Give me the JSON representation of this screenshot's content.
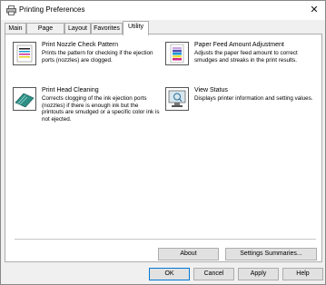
{
  "window": {
    "title": "Printing Preferences",
    "close_glyph": "✕"
  },
  "tabs": [
    {
      "label": "Main"
    },
    {
      "label": "Page Setup"
    },
    {
      "label": "Layout"
    },
    {
      "label": "Favorites"
    },
    {
      "label": "Utility",
      "active": true
    }
  ],
  "utility": {
    "nozzle_check": {
      "title": "Print Nozzle Check Pattern",
      "description": "Prints the pattern for checking if the ejection ports (nozzles) are clogged.",
      "icon": "nozzle-check-pattern-icon"
    },
    "paper_feed": {
      "title": "Paper Feed Amount Adjustment",
      "description": "Adjusts the paper feed amount to correct smudges and streaks in the print results.",
      "icon": "paper-feed-adjustment-icon"
    },
    "head_cleaning": {
      "title": "Print Head Cleaning",
      "description": "Corrects clogging of the ink ejection ports (nozzles) if there is enough ink but the printouts are smudged or a specific color ink is not ejected.",
      "icon": "print-head-cleaning-icon"
    },
    "view_status": {
      "title": "View Status",
      "description": "Displays printer information and setting values.",
      "icon": "view-status-icon"
    }
  },
  "panel_buttons": {
    "about": "About",
    "settings_summaries": "Settings Summaries..."
  },
  "dialog_buttons": {
    "ok": "OK",
    "cancel": "Cancel",
    "apply": "Apply",
    "help": "Help"
  },
  "colors": {
    "accent": "#0078d7",
    "button_face": "#e1e1e1",
    "border": "#adadad"
  }
}
